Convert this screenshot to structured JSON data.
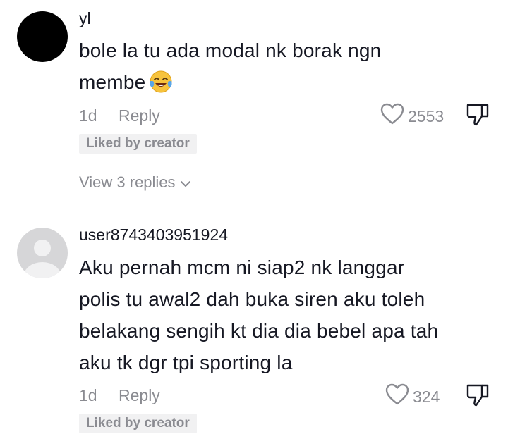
{
  "comments": [
    {
      "username": "yl",
      "text_line1": "bole la tu ada modal nk borak ngn",
      "text_line2": "membe",
      "emoji": "face-with-tears-of-joy-icon",
      "time": "1d",
      "reply_label": "Reply",
      "likes": "2553",
      "liked_badge": "Liked by creator",
      "view_replies": "View 3 replies"
    },
    {
      "username": "user8743403951924",
      "text_lines": [
        "Aku pernah mcm ni siap2 nk langgar",
        "polis tu awal2 dah buka siren aku toleh",
        "belakang sengih kt dia dia bebel apa tah",
        "aku tk dgr tpi sporting la"
      ],
      "time": "1d",
      "reply_label": "Reply",
      "likes": "324",
      "liked_badge": "Liked by creator"
    }
  ],
  "colors": {
    "text": "#161823",
    "muted": "#8a8b91",
    "badge_bg": "#f1f1f2"
  }
}
